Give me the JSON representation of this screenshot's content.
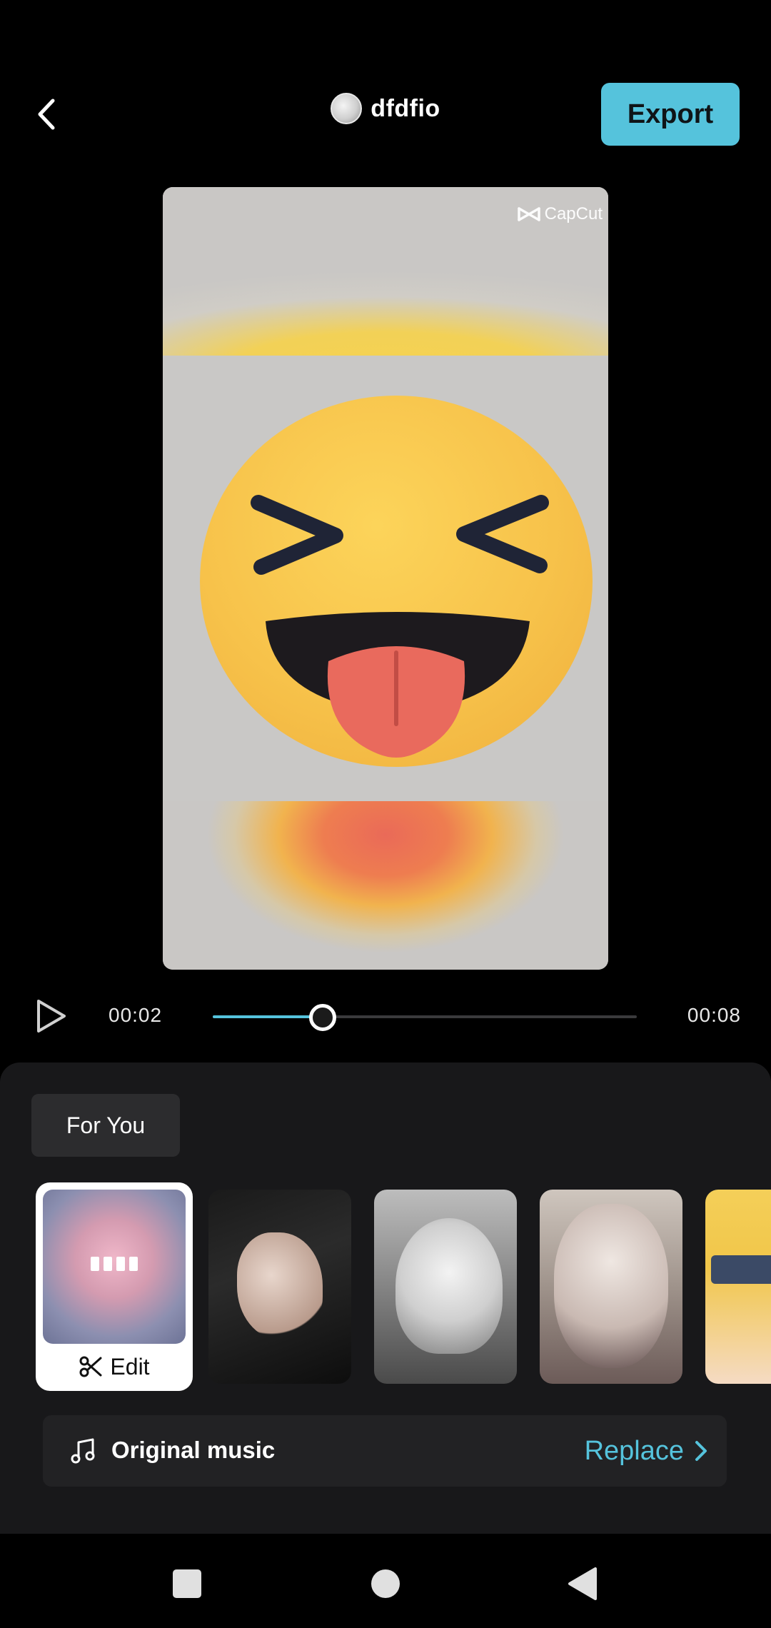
{
  "header": {
    "title": "dfdfio",
    "export_label": "Export"
  },
  "preview": {
    "watermark": "CapCut"
  },
  "player": {
    "current_time": "00:02",
    "total_time": "00:08",
    "progress": 0.26
  },
  "panel": {
    "tab_label": "For You",
    "templates": [
      {
        "id": "tpl-1",
        "selected": true,
        "action_label": "Edit"
      },
      {
        "id": "tpl-2",
        "selected": false
      },
      {
        "id": "tpl-3",
        "selected": false
      },
      {
        "id": "tpl-4",
        "selected": false
      },
      {
        "id": "tpl-5",
        "selected": false
      }
    ],
    "music": {
      "label": "Original music",
      "replace_label": "Replace"
    }
  },
  "colors": {
    "accent": "#55c3dc",
    "panel_bg": "#18181a"
  },
  "icons": [
    "chevron-left-icon",
    "play-icon",
    "scissors-icon",
    "music-note-icon",
    "chevron-right-icon",
    "square-icon",
    "circle-icon",
    "triangle-back-icon"
  ]
}
